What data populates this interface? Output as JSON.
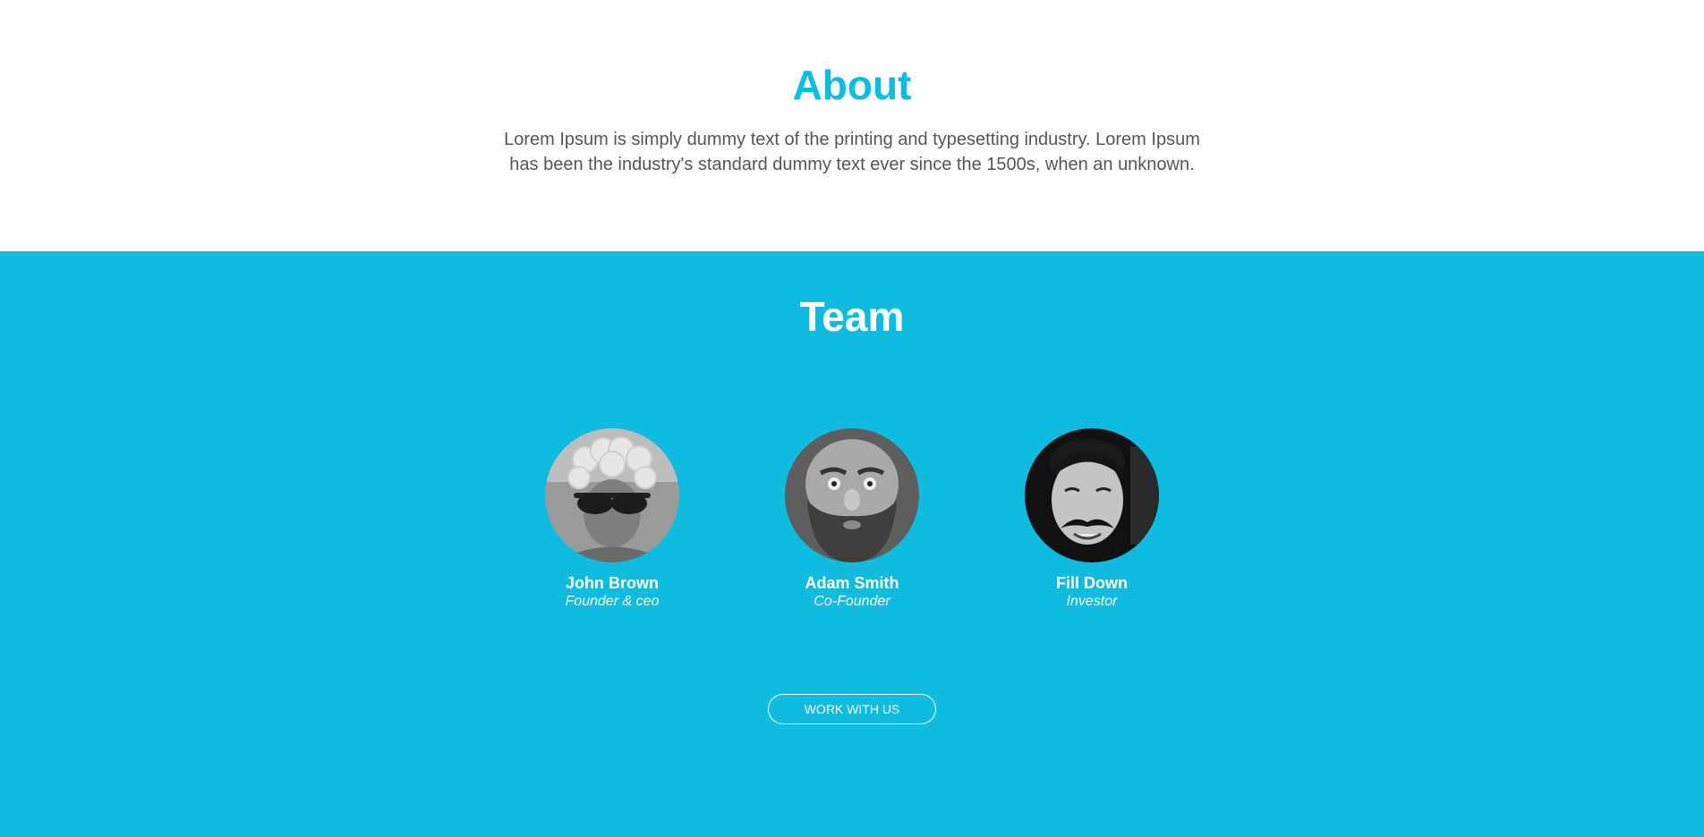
{
  "about": {
    "title": "About",
    "text": "Lorem Ipsum is simply dummy text of the printing and typesetting industry. Lorem Ipsum has been the industry's standard dummy text ever since the 1500s, when an unknown."
  },
  "team": {
    "title": "Team",
    "members": [
      {
        "name": "John Brown",
        "role": "Founder & ceo",
        "avatar": "person-curly-wig-sunglasses-photo"
      },
      {
        "name": "Adam Smith",
        "role": "Co-Founder",
        "avatar": "person-bearded-man-photo"
      },
      {
        "name": "Fill Down",
        "role": "Investor",
        "avatar": "person-mustache-man-photo"
      }
    ],
    "button_label": "WORK WITH US"
  },
  "colors": {
    "accent": "#0fbcdf",
    "body_text": "#555555",
    "white": "#ffffff"
  }
}
